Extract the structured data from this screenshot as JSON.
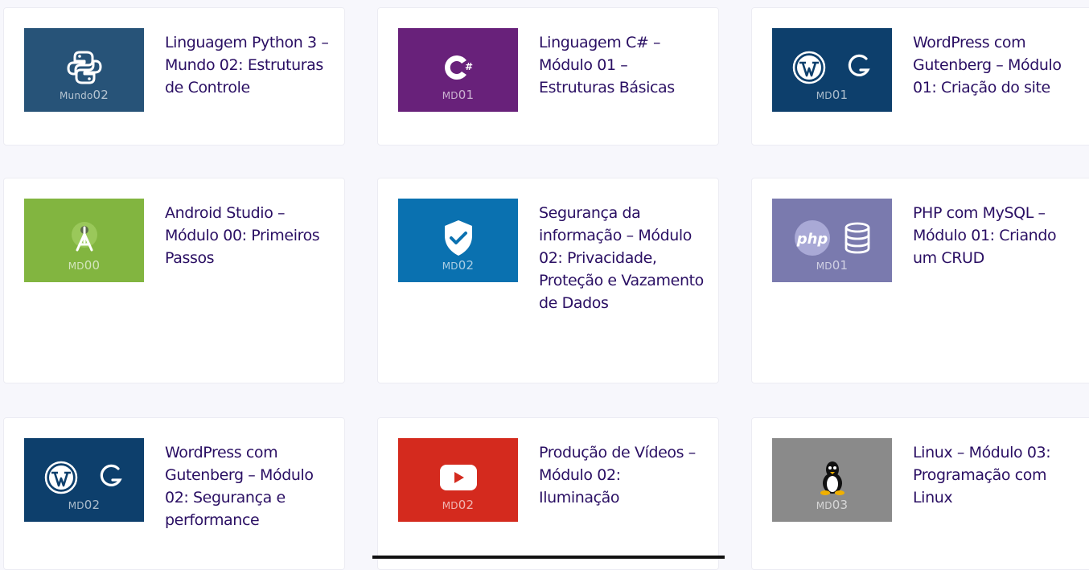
{
  "courses": [
    {
      "title": "Linguagem Python 3 – Mundo 02: Estruturas de Controle",
      "badge_prefix": "Mundo",
      "badge_num": "02",
      "thumb_color": "#275378",
      "icons": [
        "python-icon"
      ]
    },
    {
      "title": "Linguagem C# – Módulo 01 – Estruturas Básicas",
      "badge_prefix": "MD",
      "badge_num": "01",
      "thumb_color": "#68217a",
      "icons": [
        "csharp-icon"
      ]
    },
    {
      "title": "WordPress com Gutenberg – Módulo 01: Criação do site",
      "badge_prefix": "MD",
      "badge_num": "01",
      "thumb_color": "#0d3f6c",
      "icons": [
        "wordpress-icon",
        "gutenberg-icon"
      ]
    },
    {
      "title": "Android Studio – Módulo 00: Primeiros Passos",
      "badge_prefix": "MD",
      "badge_num": "00",
      "thumb_color": "#82b540",
      "icons": [
        "android-studio-icon"
      ]
    },
    {
      "title": "Segurança da informação – Módulo 02: Privacidade, Proteção e Vazamento de Dados",
      "badge_prefix": "MD",
      "badge_num": "02",
      "thumb_color": "#0a71b0",
      "icons": [
        "shield-check-icon"
      ]
    },
    {
      "title": "PHP com MySQL – Módulo 01: Criando um CRUD",
      "badge_prefix": "MD",
      "badge_num": "01",
      "thumb_color": "#7a7aae",
      "icons": [
        "php-icon",
        "database-icon"
      ]
    },
    {
      "title": "WordPress com Gutenberg – Módulo 02: Segurança e performance",
      "badge_prefix": "MD",
      "badge_num": "02",
      "thumb_color": "#0d3f6c",
      "icons": [
        "wordpress-icon",
        "gutenberg-icon"
      ]
    },
    {
      "title": "Produção de Vídeos – Módulo 02: Iluminação",
      "badge_prefix": "MD",
      "badge_num": "02",
      "thumb_color": "#d42a1e",
      "icons": [
        "youtube-icon"
      ]
    },
    {
      "title": "Linux – Módulo 03: Programação com Linux",
      "badge_prefix": "MD",
      "badge_num": "03",
      "thumb_color": "#8a8a8a",
      "icons": [
        "linux-tux-icon"
      ]
    }
  ],
  "php_label": "php"
}
